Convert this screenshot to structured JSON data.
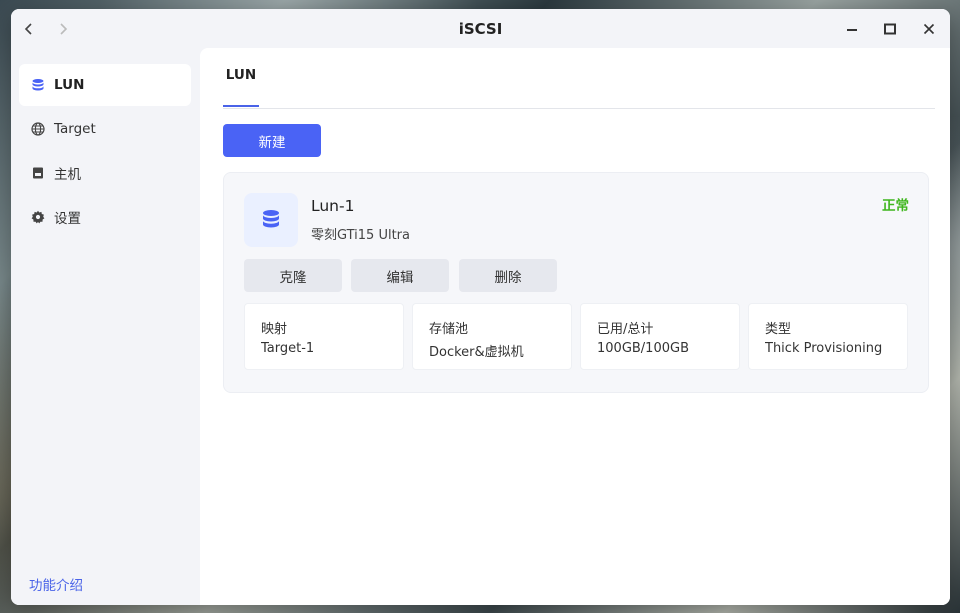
{
  "window": {
    "title": "iSCSI"
  },
  "sidebar": {
    "items": [
      {
        "label": "LUN",
        "icon": "database-icon",
        "active": true
      },
      {
        "label": "Target",
        "icon": "globe-icon",
        "active": false
      },
      {
        "label": "主机",
        "icon": "server-icon",
        "active": false
      },
      {
        "label": "设置",
        "icon": "gear-icon",
        "active": false
      }
    ],
    "footer_link": "功能介绍"
  },
  "main": {
    "tabs": [
      {
        "label": "LUN",
        "active": true
      }
    ],
    "new_button": "新建",
    "lun": {
      "name": "Lun-1",
      "device": "零刻GTi15 Ultra",
      "status": "正常",
      "status_color": "#3fb61d",
      "actions": [
        "克隆",
        "编辑",
        "删除"
      ],
      "info": [
        {
          "key": "映射",
          "value": "Target-1"
        },
        {
          "key": "存储池",
          "value": "Docker&虚拟机"
        },
        {
          "key": "已用/总计",
          "value": "100GB/100GB"
        },
        {
          "key": "类型",
          "value": "Thick Provisioning"
        }
      ]
    }
  },
  "colors": {
    "accent": "#4a63f5",
    "link": "#4a63e8"
  }
}
